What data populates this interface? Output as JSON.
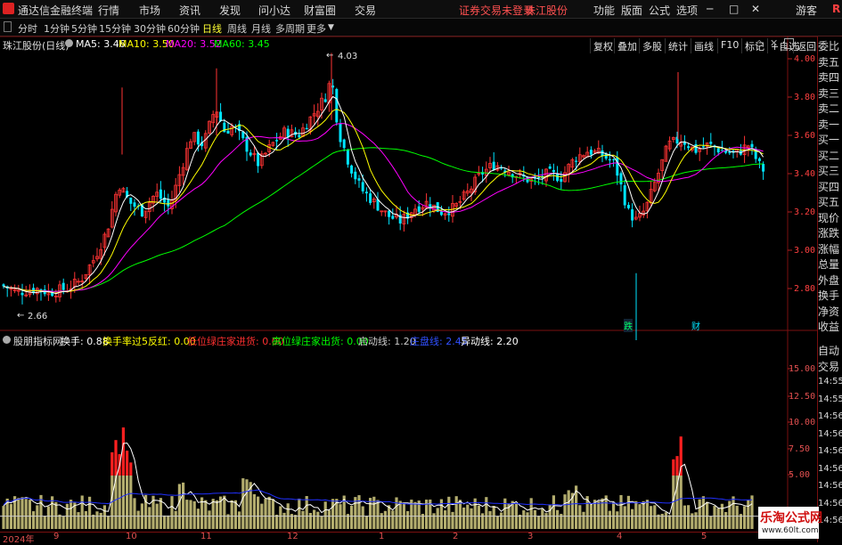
{
  "app": {
    "title": "通达信金融终端",
    "menu": [
      "行情",
      "市场",
      "资讯",
      "发现",
      "问小达",
      "财富圈",
      "交易"
    ],
    "notice": "证券交易未登录",
    "stock_name_top": "珠江股份",
    "right_menu": [
      "功能",
      "版面",
      "公式",
      "选项"
    ],
    "guest": "游客",
    "corner": "R"
  },
  "periods": {
    "items": [
      "分时",
      "1分钟",
      "5分钟",
      "15分钟",
      "30分钟",
      "60分钟",
      "日线",
      "周线",
      "月线",
      "多周期",
      "更多"
    ],
    "active": "日线"
  },
  "toolbar_right": [
    "复权",
    "叠加",
    "多股",
    "统计",
    "画线",
    "F10",
    "标记",
    "+自选",
    "返回"
  ],
  "main_chart": {
    "title": "珠江股份(日线)",
    "ma": [
      {
        "label": "MA5: 3.46",
        "color": "#ffffff"
      },
      {
        "label": "MA10: 3.50",
        "color": "#ffff00"
      },
      {
        "label": "MA20: 3.52",
        "color": "#ff00ff"
      },
      {
        "label": "MA60: 3.45",
        "color": "#00ff00"
      }
    ],
    "high_label": "4.03",
    "low_label": "2.66",
    "y_ticks": [
      "4.00",
      "3.80",
      "3.60",
      "3.40",
      "3.20",
      "3.00",
      "2.80"
    ],
    "markers": [
      "跌",
      "财"
    ]
  },
  "indicator": {
    "name": "股朋指标网",
    "items": [
      {
        "label": "换手: 0.88",
        "color": "#ffffff"
      },
      {
        "label": "换手率过5反红: 0.00",
        "color": "#ffff00"
      },
      {
        "label": "低位绿庄家进货: 0.00",
        "color": "#ff3030"
      },
      {
        "label": "高位绿庄家出货: 0.00",
        "color": "#00ff00"
      },
      {
        "label": "启动线: 1.20",
        "color": "#cccccc"
      },
      {
        "label": "庄盘线: 2.45",
        "color": "#3050ff"
      },
      {
        "label": "异动线: 2.20",
        "color": "#ffffff"
      }
    ],
    "y_ticks": [
      "15.00",
      "12.50",
      "10.00",
      "7.50",
      "5.00"
    ]
  },
  "x_axis": [
    "2024年",
    "9",
    "10",
    "11",
    "12",
    "1",
    "2",
    "3",
    "4",
    "5"
  ],
  "side_panel": {
    "items": [
      "委比",
      "卖五",
      "卖四",
      "卖三",
      "卖二",
      "卖一",
      "买一",
      "买二",
      "买三",
      "买四",
      "买五",
      "现价",
      "涨跌",
      "涨幅",
      "总量",
      "外盘",
      "换手",
      "净资",
      "收益"
    ],
    "bottom_items": [
      "自动",
      "交易"
    ],
    "times": [
      "14:55",
      "14:55",
      "14:56",
      "14:56",
      "14:56",
      "14:56",
      "14:56",
      "14:56",
      "14:56"
    ]
  },
  "watermark": {
    "name": "乐淘公式网",
    "url": "www.60lt.com"
  },
  "colors": {
    "up": "#ff3333",
    "down": "#00e5ff",
    "ma5": "#ffffff",
    "ma10": "#ffff00",
    "ma20": "#ff00ff",
    "ma60": "#00ff00",
    "volume": "#b3ad6e",
    "volume_red": "#ff2020"
  }
}
